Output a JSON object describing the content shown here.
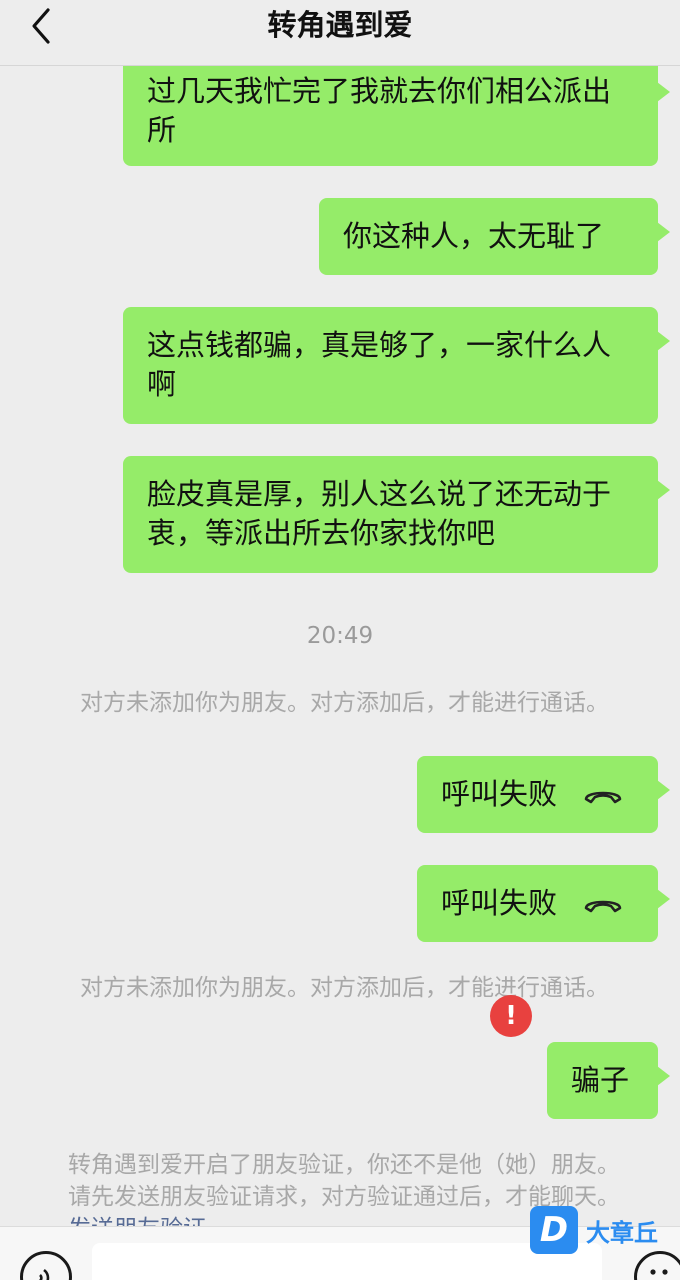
{
  "header": {
    "title": "转角遇到爱"
  },
  "messages": {
    "m1": "过几天我忙完了我就去你们相公派出所",
    "m2": "你这种人，太无耻了",
    "m3": "这点钱都骗，真是够了，一家什么人啊",
    "m4": "脸皮真是厚，别人这么说了还无动于衷，等派出所去你家找你吧",
    "time": "20:49",
    "sys1": "对方未添加你为朋友。对方添加后，才能进行通话。",
    "call1": "呼叫失败",
    "call2": "呼叫失败",
    "sys2": "对方未添加你为朋友。对方添加后，才能进行通话。",
    "m5": "骗子",
    "verify_line1": "转角遇到爱开启了朋友验证，你还不是他（她）朋友。",
    "verify_line2": "请先发送朋友验证请求，对方验证通过后，才能聊天。",
    "verify_link": "发送朋友验证"
  },
  "icons": {
    "back": "chevron-left-icon",
    "hangup": "phone-hangup-icon",
    "error": "exclamation-icon",
    "voice": "voice-icon",
    "emoji": "emoji-icon"
  },
  "colors": {
    "bubble": "#95ec69",
    "error": "#e8413f",
    "link": "#576b95",
    "watermark": "#2b8cf0"
  },
  "watermark": {
    "logo_letter": "D",
    "text": "大章丘"
  },
  "error_mark": "!"
}
